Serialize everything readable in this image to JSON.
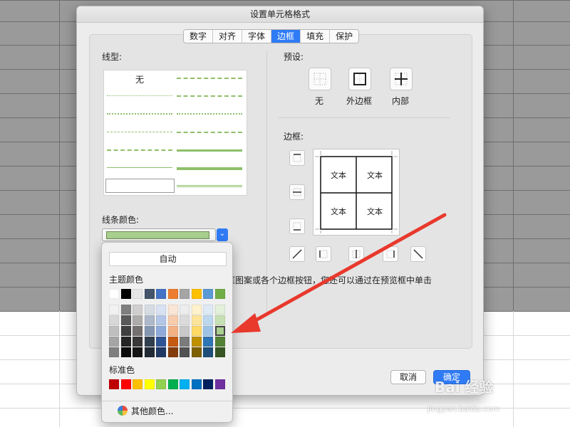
{
  "dialog": {
    "title": "设置单元格格式",
    "tabs": [
      {
        "label": "数字"
      },
      {
        "label": "对齐"
      },
      {
        "label": "字体"
      },
      {
        "label": "边框"
      },
      {
        "label": "填充"
      },
      {
        "label": "保护"
      }
    ],
    "active_tab": "边框"
  },
  "line_style": {
    "label": "线型:",
    "none_label": "无",
    "line_color_label": "线条颜色:",
    "selected_color": "#a9d08e"
  },
  "presets": {
    "label": "预设:",
    "items": [
      {
        "label": "无"
      },
      {
        "label": "外边框"
      },
      {
        "label": "内部"
      }
    ]
  },
  "border": {
    "label": "边框:",
    "preview_text": [
      "文本",
      "文本",
      "文本",
      "文本"
    ]
  },
  "hint_text": "框图案或各个边框按钮，您还可以通过在预览框中单击",
  "buttons": {
    "cancel": "取消",
    "ok": "确定"
  },
  "color_popup": {
    "auto_label": "自动",
    "theme_label": "主题颜色",
    "standard_label": "标准色",
    "more_label": "其他颜色...",
    "theme_top": [
      "#ffffff",
      "#000000",
      "#e7e6e6",
      "#44546a",
      "#4472c4",
      "#ed7d31",
      "#a5a5a5",
      "#ffc000",
      "#5b9bd5",
      "#70ad47"
    ],
    "theme_shades": [
      [
        "#f2f2f2",
        "#7f7f7f",
        "#d0cece",
        "#d6dce4",
        "#d9e2f3",
        "#fbe5d5",
        "#ededed",
        "#fff2cc",
        "#deebf6",
        "#e2efd9"
      ],
      [
        "#d8d8d8",
        "#595959",
        "#aeabab",
        "#adb9ca",
        "#b4c6e7",
        "#f7cbac",
        "#dbdbdb",
        "#fee599",
        "#bdd7ee",
        "#c5e0b3"
      ],
      [
        "#bfbfbf",
        "#3f3f3f",
        "#757070",
        "#8496b0",
        "#8eaadb",
        "#f4b183",
        "#c9c9c9",
        "#ffd965",
        "#9cc3e5",
        "#a9d08e"
      ],
      [
        "#a5a5a5",
        "#262626",
        "#3a3838",
        "#323f4f",
        "#2f5496",
        "#c55a11",
        "#7b7b7b",
        "#bf9000",
        "#2e75b5",
        "#538135"
      ],
      [
        "#7f7f7f",
        "#0c0c0c",
        "#171616",
        "#222a35",
        "#1f3864",
        "#833c0b",
        "#525252",
        "#7f6000",
        "#1e4e79",
        "#375623"
      ]
    ],
    "standard": [
      "#c00000",
      "#ff0000",
      "#ffc000",
      "#ffff00",
      "#92d050",
      "#00b050",
      "#00b0f0",
      "#0070c0",
      "#002060",
      "#7030a0"
    ],
    "selected_shade": {
      "row": 2,
      "col": 9
    }
  },
  "watermark": {
    "text": "Bai 经验",
    "url_text": "jingyan.baidu.com"
  }
}
